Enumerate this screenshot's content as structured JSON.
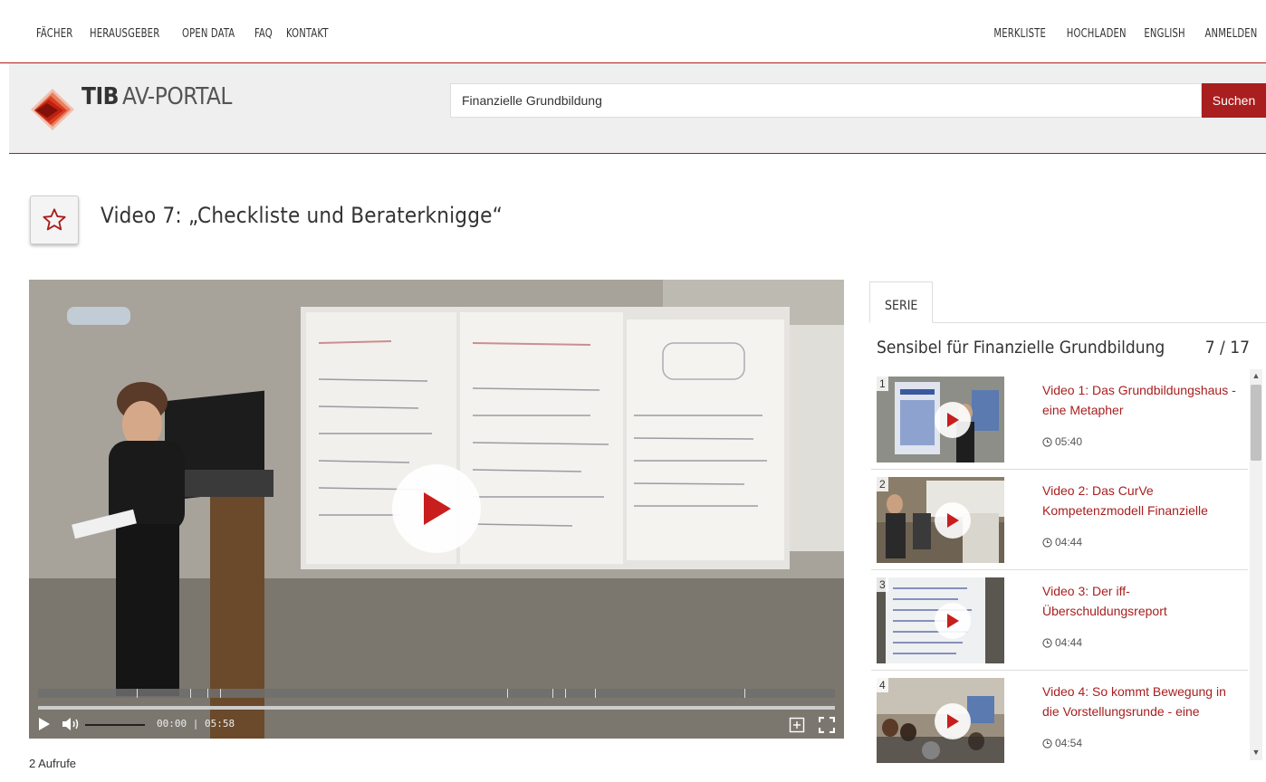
{
  "nav": {
    "left": [
      "FÄCHER",
      "HERAUSGEBER",
      "OPEN DATA",
      "FAQ",
      "KONTAKT"
    ],
    "right": [
      "MERKLISTE",
      "HOCHLADEN",
      "ENGLISH",
      "ANMELDEN"
    ]
  },
  "header": {
    "logo_bold": "TIB",
    "logo_light": "AV-PORTAL",
    "search_value": "Finanzielle Grundbildung",
    "search_button": "Suchen"
  },
  "page": {
    "title": "Video 7: „Checkliste und Beraterknigge“",
    "views": "2 Aufrufe"
  },
  "player": {
    "time": "00:00 | 05:58",
    "progress": 0.0
  },
  "series": {
    "tab": "SERIE",
    "title": "Sensibel für Finanzielle Grundbildung",
    "count": "7 / 17",
    "items": [
      {
        "num": "1",
        "title": "Video 1: Das Grundbildungshaus - eine Metapher",
        "duration": "05:40"
      },
      {
        "num": "2",
        "title": "Video 2: Das CurVe Kompetenzmodell Finanzielle",
        "duration": "04:44"
      },
      {
        "num": "3",
        "title": "Video 3: Der iff-Überschuldungsreport",
        "duration": "04:44"
      },
      {
        "num": "4",
        "title": "Video 4: So kommt Bewegung in die Vorstellungsrunde - eine",
        "duration": "04:54"
      }
    ]
  },
  "colors": {
    "accent": "#a91e1e",
    "header_bg": "#efefef"
  }
}
